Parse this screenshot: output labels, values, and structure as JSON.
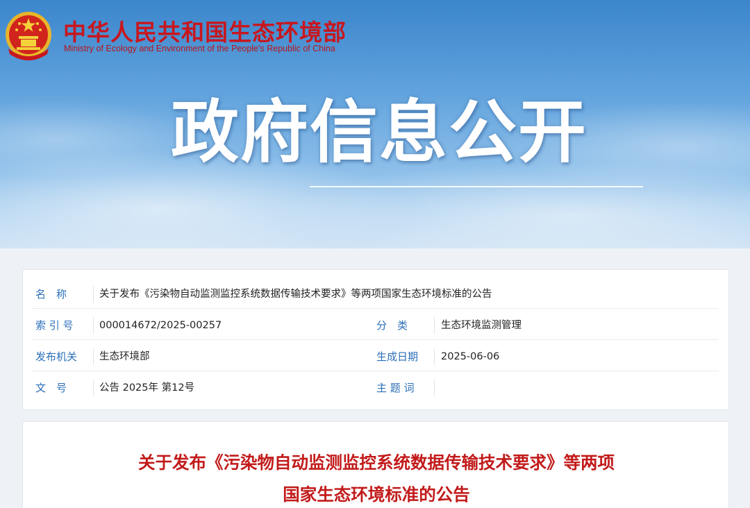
{
  "header": {
    "org_name_cn": "中华人民共和国生态环境部",
    "org_name_en": "Ministry of Ecology and Environment of the People's Republic of China",
    "banner_title": "政府信息公开"
  },
  "info": {
    "name_label": "名　称",
    "name_value": "关于发布《污染物自动监测监控系统数据传输技术要求》等两项国家生态环境标准的公告",
    "index_label": "索 引 号",
    "index_value": "000014672/2025-00257",
    "category_label": "分　类",
    "category_value": "生态环境监测管理",
    "issuer_label": "发布机关",
    "issuer_value": "生态环境部",
    "date_label": "生成日期",
    "date_value": "2025-06-06",
    "doc_no_label": "文　号",
    "doc_no_value": "公告 2025年 第12号",
    "subject_label": "主 题 词",
    "subject_value": ""
  },
  "article": {
    "title_line1": "关于发布《污染物自动监测监控系统数据传输技术要求》等两项",
    "title_line2": "国家生态环境标准的公告"
  },
  "colors": {
    "brand_red": "#c8171e",
    "label_blue": "#2b6fb8",
    "title_red": "#c21a1a"
  }
}
